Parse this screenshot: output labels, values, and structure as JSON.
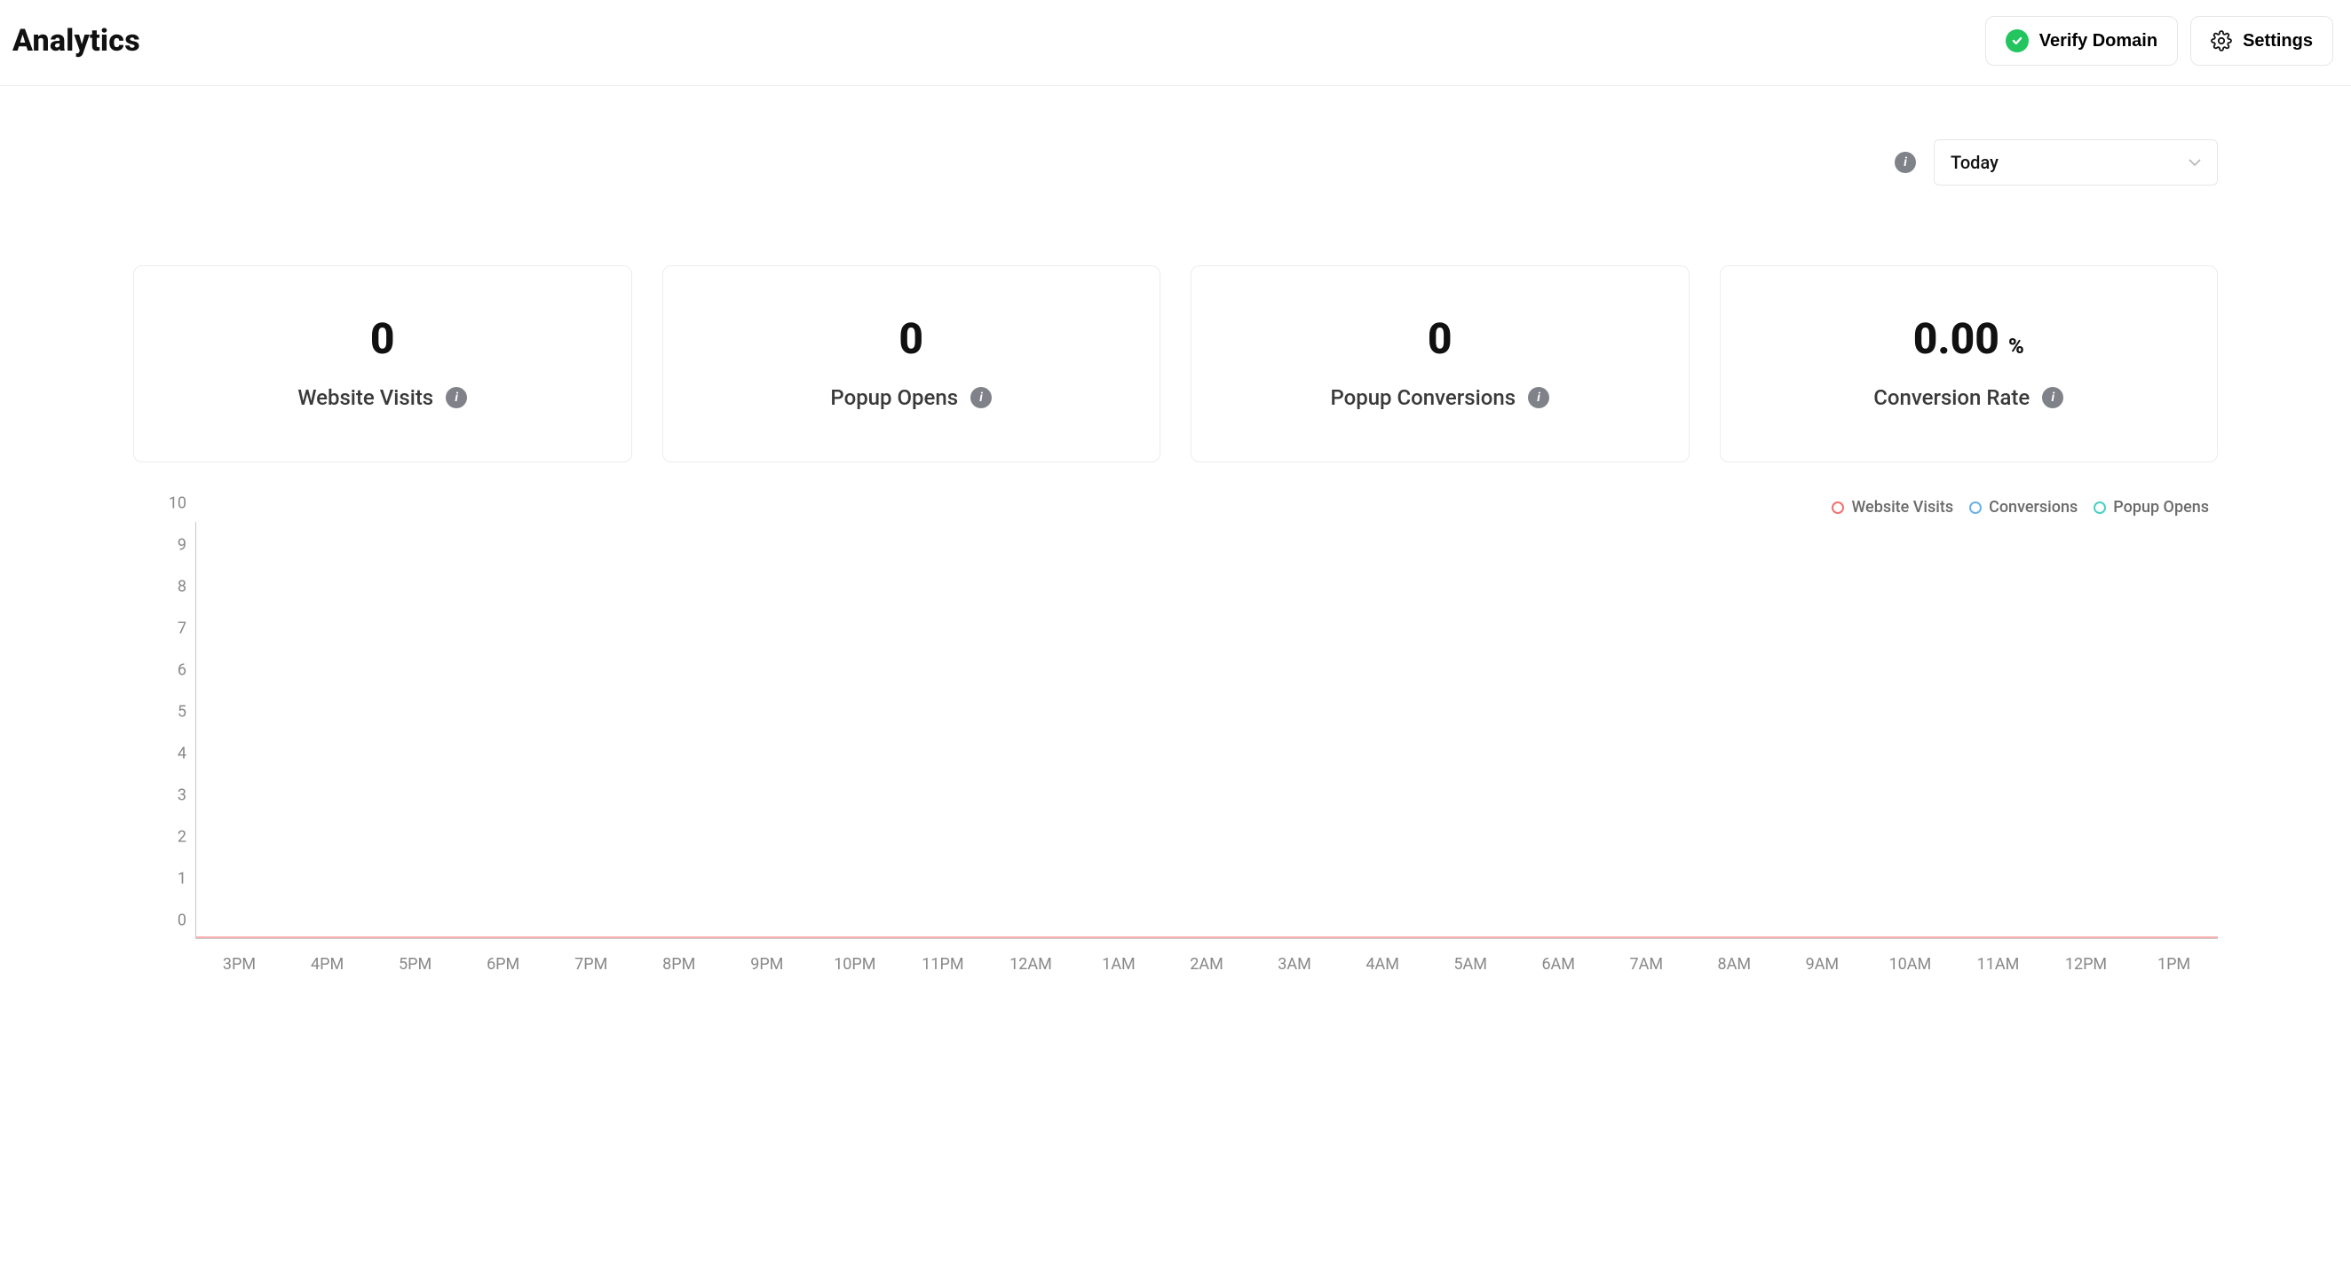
{
  "header": {
    "title": "Analytics",
    "verify_label": "Verify Domain",
    "settings_label": "Settings"
  },
  "controls": {
    "range_selected": "Today"
  },
  "cards": [
    {
      "value": "0",
      "unit": "",
      "label": "Website Visits"
    },
    {
      "value": "0",
      "unit": "",
      "label": "Popup Opens"
    },
    {
      "value": "0",
      "unit": "",
      "label": "Popup Conversions"
    },
    {
      "value": "0.00",
      "unit": "%",
      "label": "Conversion Rate"
    }
  ],
  "legend": {
    "series1": "Website Visits",
    "series2": "Conversions",
    "series3": "Popup Opens"
  },
  "chart_data": {
    "type": "line",
    "ylabel": "",
    "xlabel": "",
    "ylim": [
      0,
      10
    ],
    "y_ticks": [
      0,
      1,
      2,
      3,
      4,
      5,
      6,
      7,
      8,
      9,
      10
    ],
    "x_categories": [
      "3PM",
      "4PM",
      "5PM",
      "6PM",
      "7PM",
      "8PM",
      "9PM",
      "10PM",
      "11PM",
      "12AM",
      "1AM",
      "2AM",
      "3AM",
      "4AM",
      "5AM",
      "6AM",
      "7AM",
      "8AM",
      "9AM",
      "10AM",
      "11AM",
      "12PM",
      "1PM"
    ],
    "series": [
      {
        "name": "Website Visits",
        "color": "#f36f6f",
        "values": [
          0,
          0,
          0,
          0,
          0,
          0,
          0,
          0,
          0,
          0,
          0,
          0,
          0,
          0,
          0,
          0,
          0,
          0,
          0,
          0,
          0,
          0,
          0
        ]
      },
      {
        "name": "Conversions",
        "color": "#6ab0e8",
        "values": [
          0,
          0,
          0,
          0,
          0,
          0,
          0,
          0,
          0,
          0,
          0,
          0,
          0,
          0,
          0,
          0,
          0,
          0,
          0,
          0,
          0,
          0,
          0
        ]
      },
      {
        "name": "Popup Opens",
        "color": "#46d1c2",
        "values": [
          0,
          0,
          0,
          0,
          0,
          0,
          0,
          0,
          0,
          0,
          0,
          0,
          0,
          0,
          0,
          0,
          0,
          0,
          0,
          0,
          0,
          0,
          0
        ]
      }
    ]
  }
}
